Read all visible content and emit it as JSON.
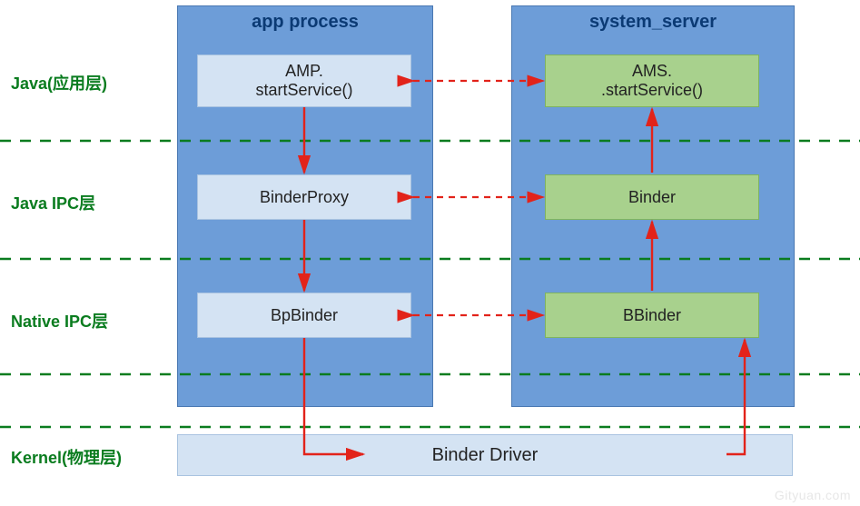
{
  "columns": {
    "left_title": "app process",
    "right_title": "system_server"
  },
  "layers": {
    "java_app": "Java(应用层)",
    "java_ipc": "Java IPC层",
    "native_ipc": "Native IPC层",
    "kernel": "Kernel(物理层)"
  },
  "boxes": {
    "left_app_l1": "AMP.",
    "left_app_l2": "startService()",
    "left_ipc": "BinderProxy",
    "left_native": "BpBinder",
    "right_app_l1": "AMS.",
    "right_app_l2": ".startService()",
    "right_ipc": "Binder",
    "right_native": "BBinder"
  },
  "driver": "Binder Driver",
  "watermark": "Gityuan.com",
  "colors": {
    "layer_divider": "#0a7c1f",
    "arrow_red": "#e2231a"
  }
}
